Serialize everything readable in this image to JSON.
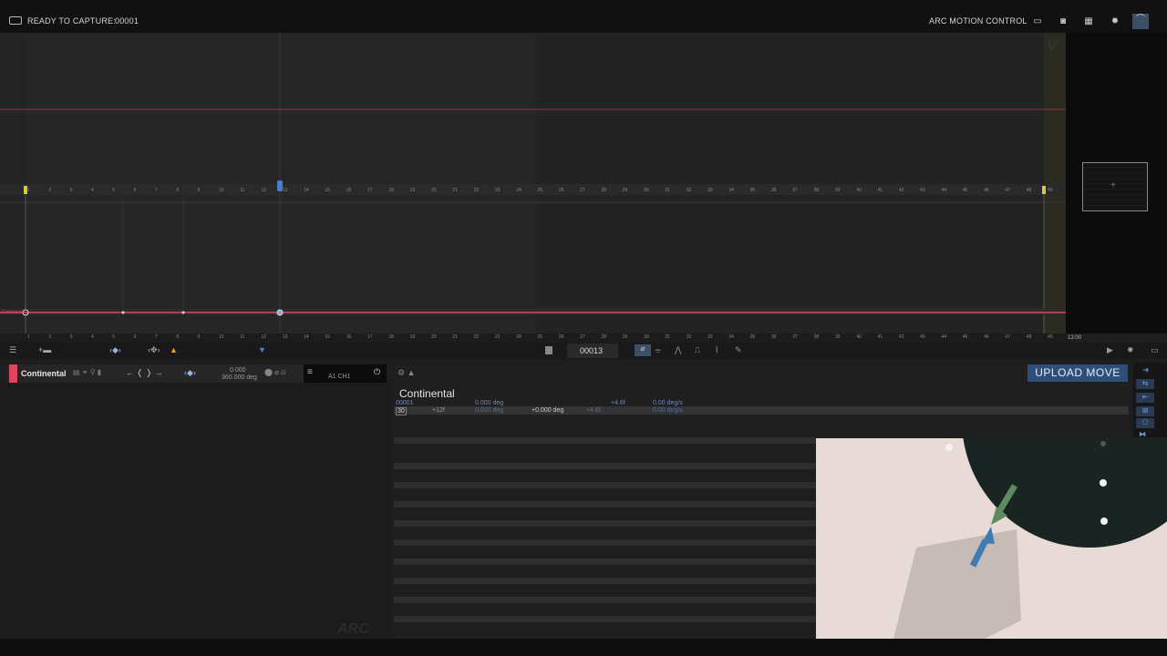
{
  "topbar": {
    "status": "READY TO CAPTURE:",
    "frame": "00001",
    "brand": "ARC MOTION CONTROL"
  },
  "graph": {
    "ruler_numbers": [
      "1",
      "2",
      "3",
      "4",
      "5",
      "6",
      "7",
      "8",
      "9",
      "10",
      "11",
      "12",
      "13",
      "14",
      "15",
      "16",
      "17",
      "18",
      "19",
      "20",
      "21",
      "22",
      "23",
      "24",
      "25",
      "26",
      "27",
      "28",
      "29",
      "30",
      "31",
      "32",
      "33",
      "34",
      "35",
      "36",
      "37",
      "38",
      "39",
      "40",
      "41",
      "42",
      "43",
      "44",
      "45",
      "46",
      "47",
      "48",
      "49"
    ],
    "corner_letter": "V",
    "track_label": "Continental",
    "end_time": "13:00"
  },
  "toolbar": {
    "current_frame": "00013"
  },
  "channel": {
    "name": "Continental",
    "value_top": "0.000",
    "value_bottom": "360.000 deg",
    "channel_id": "A1 CH1",
    "color": "#e0445e"
  },
  "details": {
    "name": "Continental",
    "row1": {
      "frame": "00001",
      "pos": "0.000 deg",
      "ease": "+4.6f",
      "speed": "0.00 deg/s"
    },
    "row2": {
      "frame": "30",
      "offset": "+12f",
      "pos": "0.000 deg",
      "delta": "+0.000 deg",
      "ease": "+4.6f",
      "speed": "0.00 deg/s"
    }
  },
  "upload_button": "UPLOAD MOVE",
  "watermark": "ARC",
  "colors": {
    "accent": "#2e4f7a",
    "channel_red": "#e0445e",
    "playhead_blue": "#4a7fd0"
  }
}
